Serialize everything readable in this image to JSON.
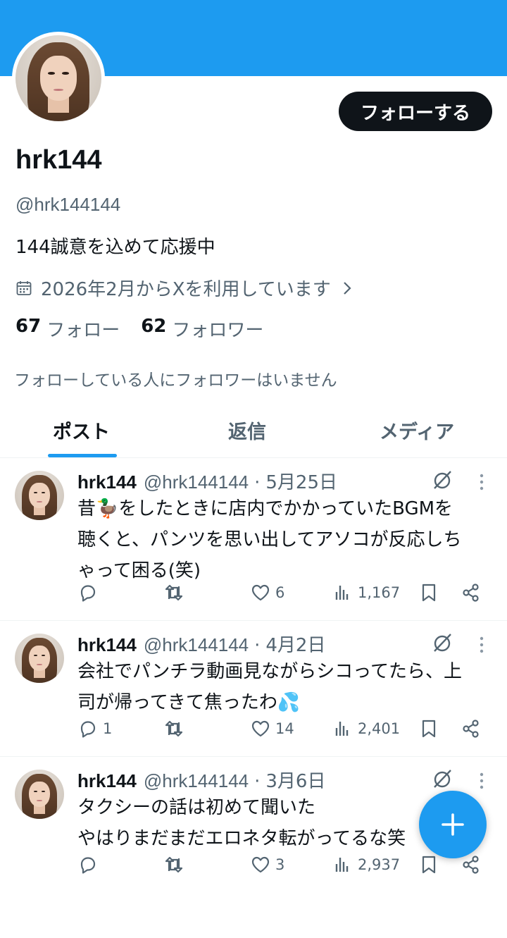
{
  "profile": {
    "display_name": "hrk144",
    "handle": "@hrk144144",
    "bio": "144誠意を込めて応援中",
    "joined": "2026年2月からXを利用しています",
    "following_count": "67",
    "following_label": "フォロー",
    "followers_count": "62",
    "followers_label": "フォロワー",
    "no_mutual_followers": "フォローしている人にフォロワーはいません",
    "follow_button_label": "フォローする"
  },
  "tabs": [
    {
      "label": "ポスト",
      "active": true
    },
    {
      "label": "返信",
      "active": false
    },
    {
      "label": "メディア",
      "active": false
    }
  ],
  "posts": [
    {
      "name": "hrk144",
      "handle": "@hrk144144",
      "separator": "·",
      "date": "5月25日",
      "text": "昔🦆をしたときに店内でかかっていたBGMを\n聴くと、パンツを思い出してアソコが反応しち\nゃって困る(笑)",
      "replies": "",
      "reposts": "",
      "likes": "6",
      "views": "1,167"
    },
    {
      "name": "hrk144",
      "handle": "@hrk144144",
      "separator": "·",
      "date": "4月2日",
      "text": "会社でパンチラ動画見ながらシコってたら、上\n司が帰ってきて焦ったわ💦",
      "replies": "1",
      "reposts": "",
      "likes": "14",
      "views": "2,401"
    },
    {
      "name": "hrk144",
      "handle": "@hrk144144",
      "separator": "·",
      "date": "3月6日",
      "text": "タクシーの話は初めて聞いた\nやはりまだまだエロネタ転がってるな笑",
      "replies": "",
      "reposts": "",
      "likes": "3",
      "views": "2,937"
    }
  ],
  "colors": {
    "accent": "#1d9bf0",
    "text_primary": "#0f1419",
    "text_secondary": "#536471",
    "divider": "#eff3f4"
  },
  "icons": {
    "calendar": "calendar-icon",
    "chevron": "chevron-right-icon",
    "reply": "reply-icon",
    "repost": "repost-icon",
    "like": "heart-icon",
    "views": "views-icon",
    "bookmark": "bookmark-icon",
    "share": "share-icon",
    "grok": "grok-icon",
    "more": "more-icon",
    "compose": "plus-icon"
  }
}
